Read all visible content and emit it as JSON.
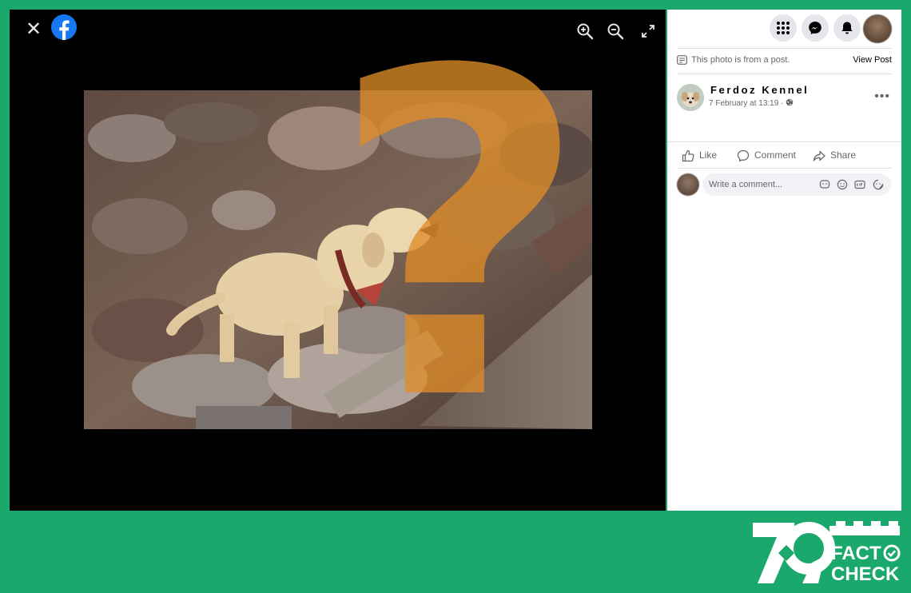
{
  "viewer": {
    "close_symbol": "✕",
    "icons": [
      "close-icon",
      "facebook-logo",
      "zoom-in-icon",
      "zoom-out-icon",
      "fullscreen-icon"
    ],
    "overlay_mark": "?"
  },
  "panel": {
    "top_icons": [
      "menu-grid-icon",
      "messenger-icon",
      "notifications-icon",
      "account-avatar"
    ],
    "from_post_text": "This photo is from a post.",
    "view_post_label": "View Post",
    "author_name": "Ferdoz Kennel",
    "post_meta": "7 February at 13:19 · ",
    "more_label": "•••",
    "actions": [
      {
        "label": "Like",
        "icon": "thumbs-up-icon"
      },
      {
        "label": "Comment",
        "icon": "comment-icon"
      },
      {
        "label": "Share",
        "icon": "share-icon"
      }
    ],
    "comment_placeholder": "Write a comment..."
  },
  "badge": {
    "number": "7 9",
    "line1": "FACT",
    "line2": "CHECK"
  },
  "colors": {
    "background": "#1aa86c",
    "facebook_blue": "#1877f2",
    "overlay_orange": "#de8c28"
  }
}
